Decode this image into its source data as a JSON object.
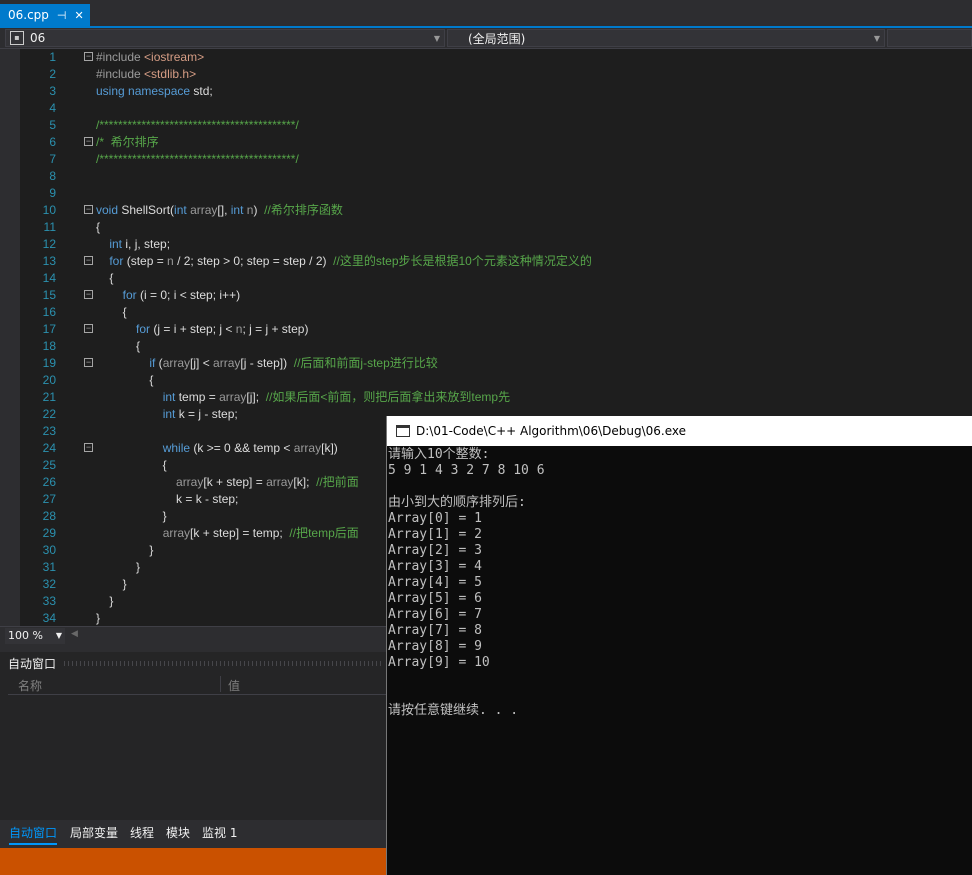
{
  "tab": {
    "filename": "06.cpp",
    "pin": "⊣",
    "close": "✕"
  },
  "nav": {
    "project": "06",
    "scope": "(全局范围)"
  },
  "editor": {
    "lines": [
      {
        "n": "1",
        "fold": "⊟",
        "code": "<span class=\"pp\">#include</span> <span class=\"str\">&lt;iostream&gt;</span>"
      },
      {
        "n": "2",
        "fold": "",
        "code": "<span class=\"pp\">#include</span> <span class=\"str\">&lt;stdlib.h&gt;</span>"
      },
      {
        "n": "3",
        "fold": "",
        "code": "<span class=\"kw\">using namespace</span> std;"
      },
      {
        "n": "4",
        "fold": "",
        "code": ""
      },
      {
        "n": "5",
        "fold": "",
        "code": "<span class=\"cm\">/******************************************/</span>"
      },
      {
        "n": "6",
        "fold": "⊟",
        "code": "<span class=\"cm\">/*  希尔排序</span>"
      },
      {
        "n": "7",
        "fold": "",
        "code": "<span class=\"cm\">/******************************************/</span>"
      },
      {
        "n": "8",
        "fold": "",
        "code": ""
      },
      {
        "n": "9",
        "fold": "",
        "code": ""
      },
      {
        "n": "10",
        "fold": "⊟",
        "code": "<span class=\"kw\">void</span> ShellSort(<span class=\"kw\">int</span> <span class=\"pm\">array</span>[], <span class=\"kw\">int</span> <span class=\"pm\">n</span>)  <span class=\"cm\">//希尔排序函数</span>"
      },
      {
        "n": "11",
        "fold": "",
        "code": "{"
      },
      {
        "n": "12",
        "fold": "",
        "code": "    <span class=\"kw\">int</span> i, j, step;"
      },
      {
        "n": "13",
        "fold": "⊟",
        "code": "    <span class=\"kw\">for</span> (step = <span class=\"pm\">n</span> / 2; step &gt; 0; step = step / 2)  <span class=\"cm\">//这里的step步长是根据10个元素这种情况定义的</span>"
      },
      {
        "n": "14",
        "fold": "",
        "code": "    {"
      },
      {
        "n": "15",
        "fold": "⊟",
        "code": "        <span class=\"kw\">for</span> (i = 0; i &lt; step; i++)"
      },
      {
        "n": "16",
        "fold": "",
        "code": "        {"
      },
      {
        "n": "17",
        "fold": "⊟",
        "code": "            <span class=\"kw\">for</span> (j = i + step; j &lt; <span class=\"pm\">n</span>; j = j + step)"
      },
      {
        "n": "18",
        "fold": "",
        "code": "            {"
      },
      {
        "n": "19",
        "fold": "⊟",
        "code": "                <span class=\"kw\">if</span> (<span class=\"pm\">array</span>[j] &lt; <span class=\"pm\">array</span>[j - step])  <span class=\"cm\">//后面和前面j-step进行比较</span>"
      },
      {
        "n": "20",
        "fold": "",
        "code": "                {"
      },
      {
        "n": "21",
        "fold": "",
        "code": "                    <span class=\"kw\">int</span> temp = <span class=\"pm\">array</span>[j];  <span class=\"cm\">//如果后面&lt;前面，则把后面拿出来放到temp先</span>"
      },
      {
        "n": "22",
        "fold": "",
        "code": "                    <span class=\"kw\">int</span> k = j - step;"
      },
      {
        "n": "23",
        "fold": "",
        "code": ""
      },
      {
        "n": "24",
        "fold": "⊟",
        "code": "                    <span class=\"kw\">while</span> (k &gt;= 0 &amp;&amp; temp &lt; <span class=\"pm\">array</span>[k])"
      },
      {
        "n": "25",
        "fold": "",
        "code": "                    {"
      },
      {
        "n": "26",
        "fold": "",
        "code": "                        <span class=\"pm\">array</span>[k + step] = <span class=\"pm\">array</span>[k];  <span class=\"cm\">//把前面</span>"
      },
      {
        "n": "27",
        "fold": "",
        "code": "                        k = k - step;"
      },
      {
        "n": "28",
        "fold": "",
        "code": "                    }"
      },
      {
        "n": "29",
        "fold": "",
        "code": "                    <span class=\"pm\">array</span>[k + step] = temp;  <span class=\"cm\">//把temp后面</span>"
      },
      {
        "n": "30",
        "fold": "",
        "code": "                }"
      },
      {
        "n": "31",
        "fold": "",
        "code": "            }"
      },
      {
        "n": "32",
        "fold": "",
        "code": "        }"
      },
      {
        "n": "33",
        "fold": "",
        "code": "    }"
      },
      {
        "n": "34",
        "fold": "",
        "code": "}"
      }
    ]
  },
  "zoom": {
    "value": "100 %"
  },
  "autos": {
    "title": "自动窗口",
    "col_name": "名称",
    "col_value": "值"
  },
  "bottom_tabs": [
    "自动窗口",
    "局部变量",
    "线程",
    "模块",
    "监视 1"
  ],
  "console": {
    "title": "D:\\01-Code\\C++ Algorithm\\06\\Debug\\06.exe",
    "lines": [
      "请输入10个整数:",
      "5 9 1 4 3 2 7 8 10 6",
      "",
      "由小到大的顺序排列后:",
      "Array[0] = 1",
      "Array[1] = 2",
      "Array[2] = 3",
      "Array[3] = 4",
      "Array[4] = 5",
      "Array[5] = 6",
      "Array[6] = 7",
      "Array[7] = 8",
      "Array[8] = 9",
      "Array[9] = 10",
      "",
      "",
      "请按任意键继续. . ."
    ]
  },
  "colors": {
    "accent": "#007acc",
    "status": "#ca5100",
    "editor_bg": "#1e1e1e",
    "console_bg": "#0c0c0c"
  }
}
